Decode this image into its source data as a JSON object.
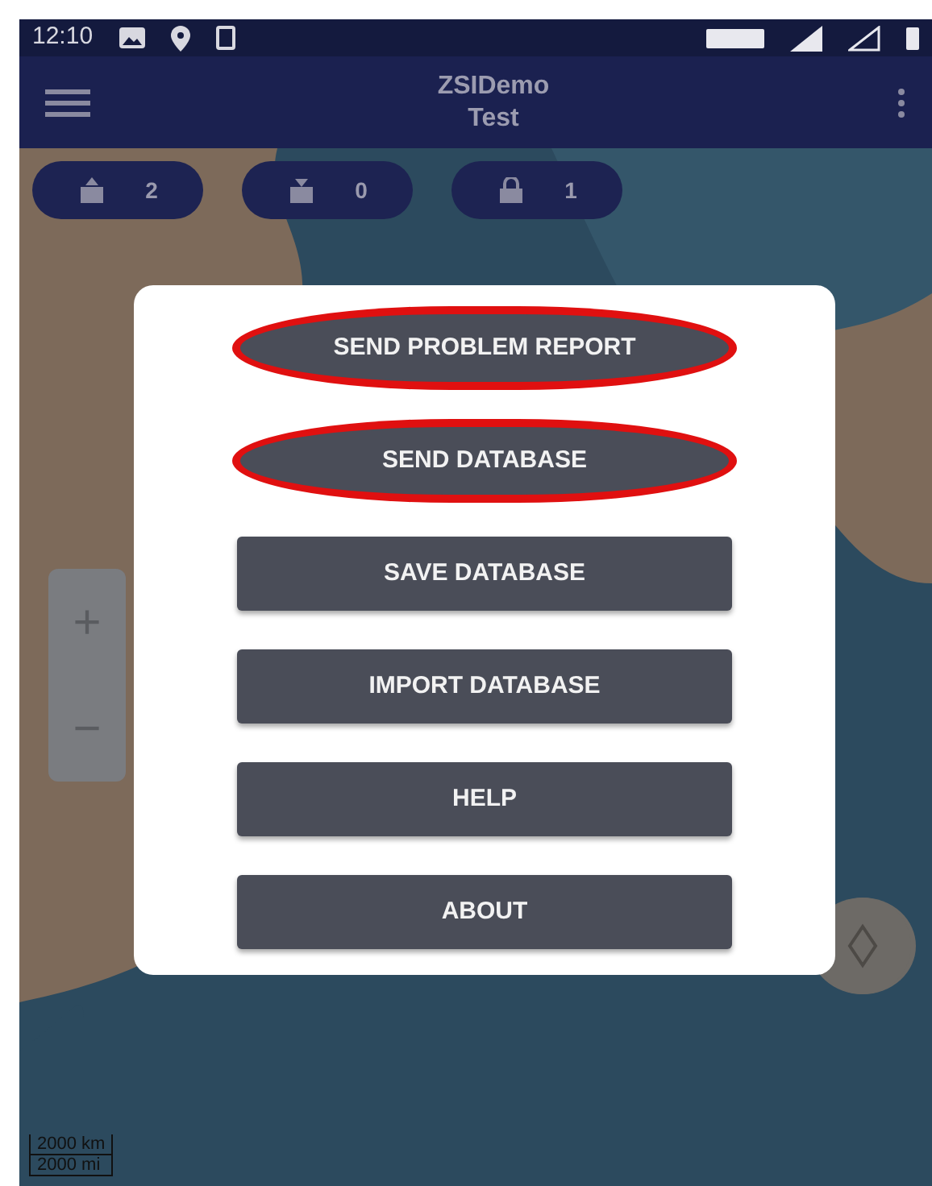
{
  "status_bar": {
    "time": "12:10"
  },
  "app_bar": {
    "title": "ZSIDemo",
    "subtitle": "Test"
  },
  "counters": [
    {
      "kind": "upload",
      "count": "2"
    },
    {
      "kind": "download",
      "count": "0"
    },
    {
      "kind": "lock",
      "count": "1"
    }
  ],
  "zoom_controls": {
    "zoom_in": "+",
    "zoom_out": "−"
  },
  "scale_bar": {
    "metric": "2000 km",
    "imperial": "2000 mi"
  },
  "menu_dialog": {
    "buttons": [
      {
        "label": "SEND PROBLEM REPORT",
        "circled": true
      },
      {
        "label": "SEND DATABASE",
        "circled": true
      },
      {
        "label": "SAVE DATABASE",
        "circled": false
      },
      {
        "label": "IMPORT DATABASE",
        "circled": false
      },
      {
        "label": "HELP",
        "circled": false
      },
      {
        "label": "ABOUT",
        "circled": false
      }
    ]
  }
}
